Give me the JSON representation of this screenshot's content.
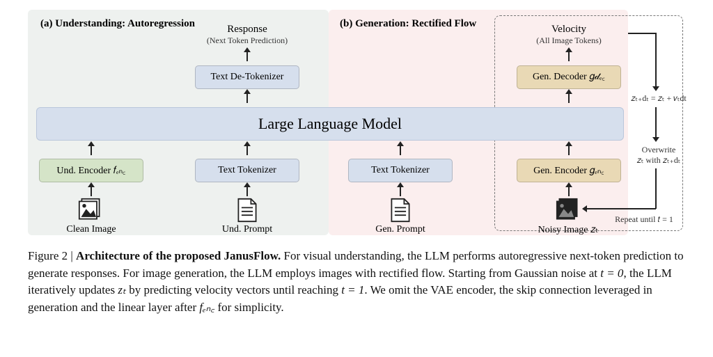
{
  "panels": {
    "a_title": "(a) Understanding: Autoregression",
    "b_title": "(b) Generation: Rectified Flow"
  },
  "llm": "Large Language Model",
  "understanding": {
    "response": "Response",
    "response_sub": "(Next Token Prediction)",
    "detokenizer": "Text De-Tokenizer",
    "und_encoder": "Und. Encoder 𝑓ₑₙ꜀",
    "text_tokenizer": "Text Tokenizer",
    "clean_image": "Clean Image",
    "und_prompt": "Und. Prompt"
  },
  "generation": {
    "velocity": "Velocity",
    "velocity_sub": "(All Image Tokens)",
    "gen_decoder": "Gen. Decoder 𝑔𝒹ₑ꜀",
    "text_tokenizer": "Text Tokenizer",
    "gen_encoder": "Gen. Encoder 𝑔ₑₙ꜀",
    "gen_prompt": "Gen. Prompt",
    "noisy_image": "Noisy Image 𝑧ₜ",
    "eq_update": "𝑧ₜ₊dₜ = 𝑧ₜ + 𝑣ₜdt",
    "overwrite": "Overwrite",
    "overwrite2": "𝑧ₜ with 𝑧ₜ₊dₜ",
    "repeat": "Repeat until 𝑡 = 1"
  },
  "caption": {
    "lead": "Figure 2 | ",
    "bold": "Architecture of the proposed JanusFlow.",
    "body1": " For visual understanding, the LLM performs autoregressive next-token prediction to generate responses. For image generation, the LLM employs images with rectified flow. Starting from Gaussian noise at ",
    "t0": "t = 0",
    "body2": ", the LLM iteratively updates ",
    "zt": "zₜ",
    "body3": " by predicting velocity vectors until reaching ",
    "t1": "t = 1",
    "body4": ". We omit the VAE encoder, the skip connection leveraged in generation and the linear layer after ",
    "fenc": "fₑₙ꜀",
    "body5": " for simplicity."
  }
}
